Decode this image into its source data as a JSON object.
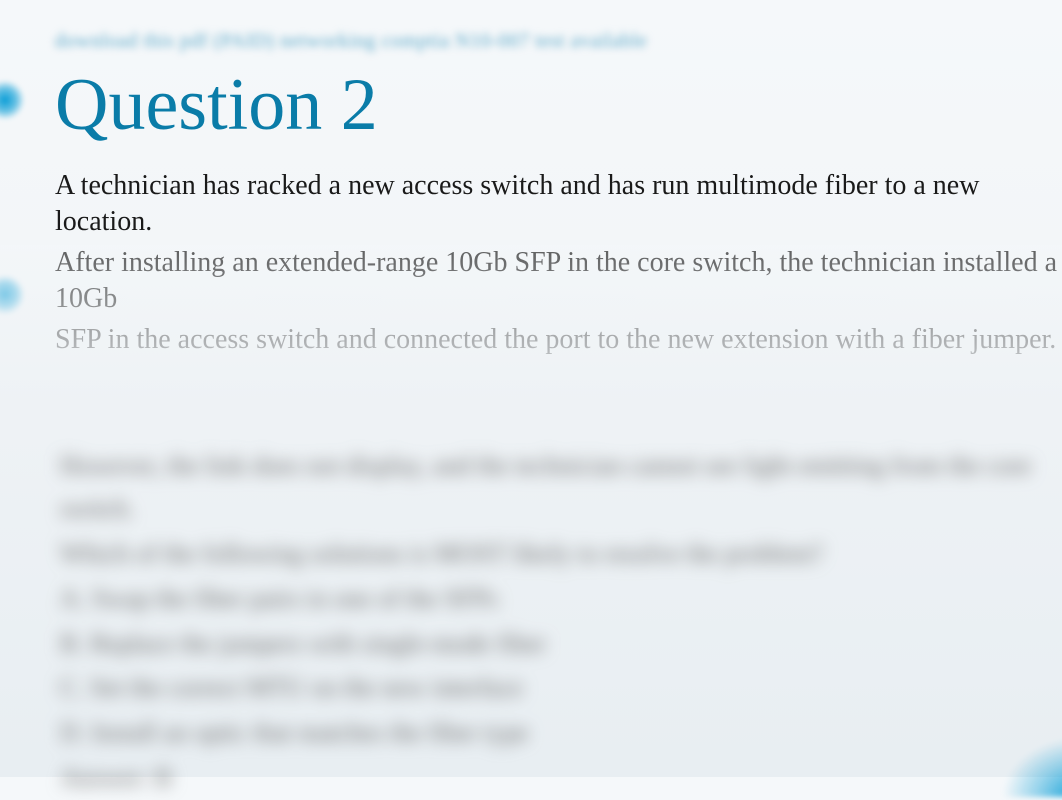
{
  "topLink": "download this pdf (PAID) networking comptia N10-007 test available",
  "title": "Question 2",
  "questionParagraphs": [
    "A technician has racked a new access switch and has run multimode fiber to a new location.",
    "After installing an extended-range 10Gb SFP in the core switch, the technician installed a 10Gb",
    "SFP in the access switch and connected the port to the new extension with a fiber jumper."
  ],
  "blurredParagraphs": [
    "However, the link does not display, and the technician cannot see light emitting from the core switch.",
    "Which of the following solutions is MOST likely to resolve the problem?",
    "A. Swap the fiber pairs in one of the SFPs",
    "B. Replace the jumpers with single-mode fiber",
    "C. Set the correct MTU on the new interface",
    "D. Install an optic that matches the fiber type",
    "Answer: B"
  ]
}
